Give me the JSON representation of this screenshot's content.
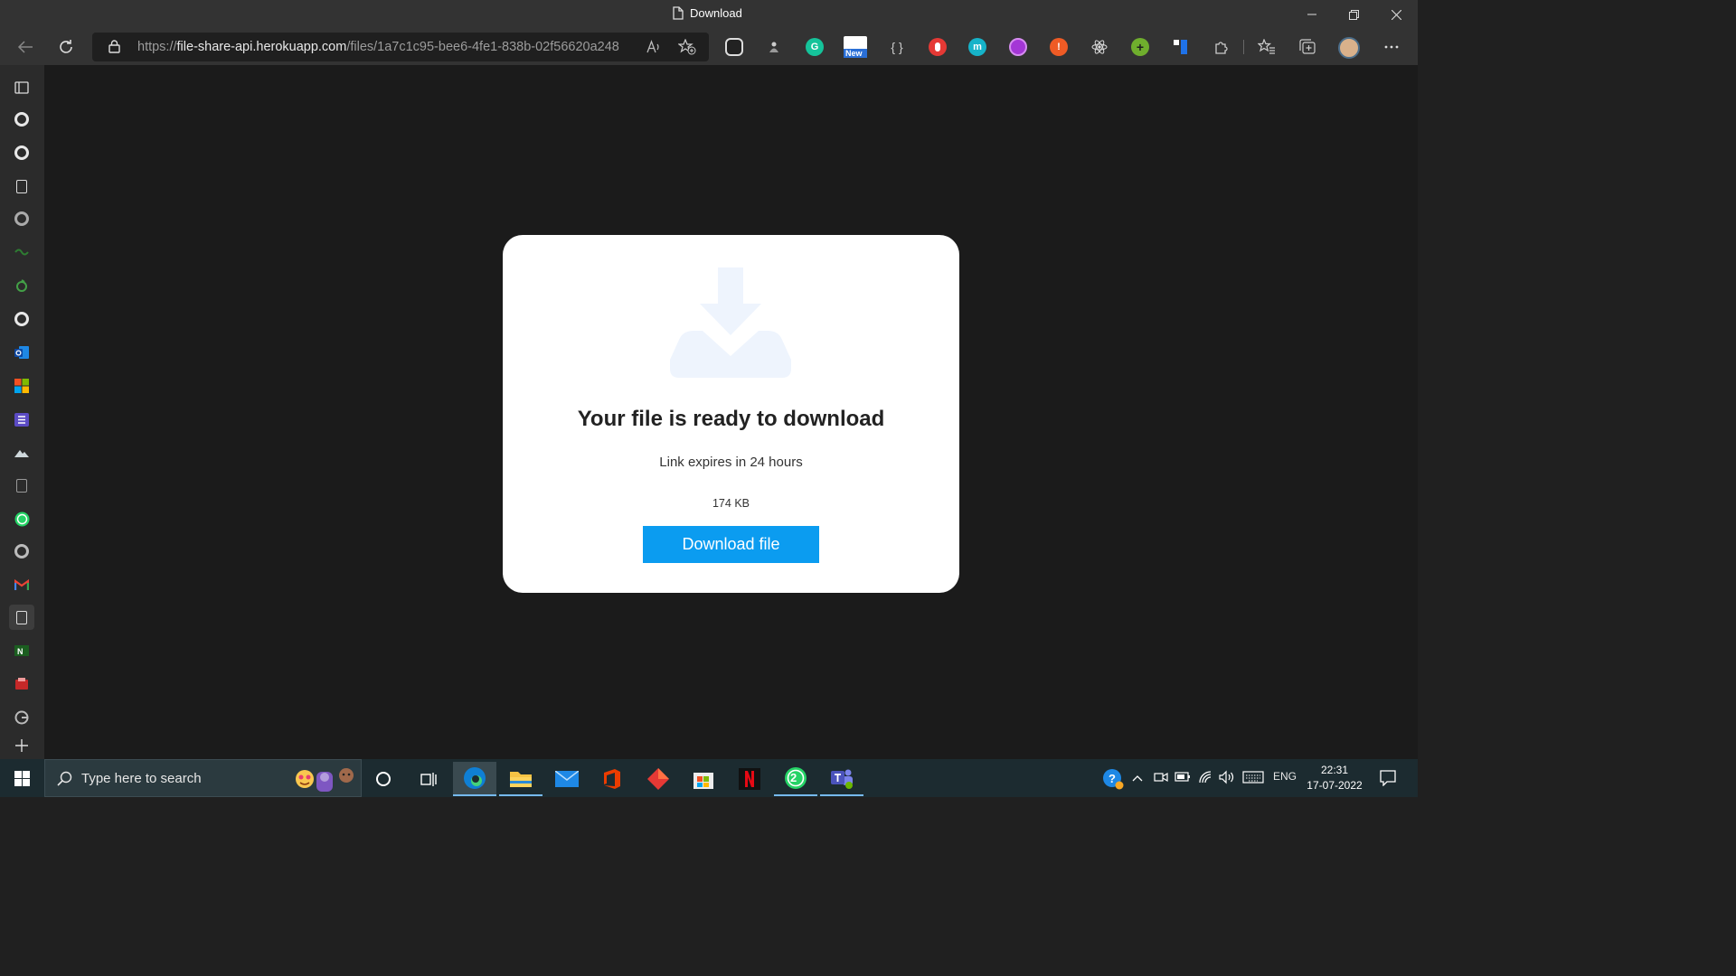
{
  "window": {
    "tab_title": "Download",
    "controls": [
      "minimize",
      "restore",
      "close"
    ]
  },
  "toolbar": {
    "url_scheme": "https://",
    "url_host": "file-share-api.herokuapp.com",
    "url_path": "/files/1a7c1c95-bee6-4fe1-838b-02f56620a248",
    "new_badge": "New",
    "extensions": [
      {
        "name": "screen-capture-icon",
        "color": "#d8d8d8"
      },
      {
        "name": "anchor-extension-icon",
        "color": "#bcbcbc"
      },
      {
        "name": "grammarly-icon",
        "color": "#15c39a",
        "label": "G"
      },
      {
        "name": "new-extension-icon",
        "color": "#2a6fd6"
      },
      {
        "name": "json-formatter-icon",
        "color": "#cccccc"
      },
      {
        "name": "hand-extension-icon",
        "color": "#e53935"
      },
      {
        "name": "m-extension-icon",
        "color": "#16b3c9",
        "label": "m"
      },
      {
        "name": "purple-extension-icon",
        "color": "#a436d6"
      },
      {
        "name": "alert-extension-icon",
        "color": "#ef5b25",
        "label": "!"
      },
      {
        "name": "react-devtools-icon",
        "color": "#d6d6d6"
      },
      {
        "name": "plus-extension-icon",
        "color": "#6fae2d",
        "label": "+"
      },
      {
        "name": "trello-icon",
        "color": "#1f72e8"
      }
    ]
  },
  "sidebar": {
    "items": [
      {
        "name": "sidebar-tab-actions-icon",
        "kind": "doc"
      },
      {
        "name": "sidebar-github-icon-1",
        "kind": "gh"
      },
      {
        "name": "sidebar-github-icon-2",
        "kind": "gh"
      },
      {
        "name": "sidebar-document-icon-1",
        "kind": "doc"
      },
      {
        "name": "sidebar-github-icon-3",
        "kind": "gh-dim"
      },
      {
        "name": "sidebar-green-icon-1",
        "kind": "green"
      },
      {
        "name": "sidebar-green-icon-2",
        "kind": "green"
      },
      {
        "name": "sidebar-github-icon-4",
        "kind": "gh"
      },
      {
        "name": "sidebar-outlook-icon",
        "kind": "outlook"
      },
      {
        "name": "sidebar-microsoft-icon",
        "kind": "ms"
      },
      {
        "name": "sidebar-forms-icon",
        "kind": "forms"
      },
      {
        "name": "sidebar-landscape-icon",
        "kind": "landscape"
      },
      {
        "name": "sidebar-document-icon-2",
        "kind": "doc-dim"
      },
      {
        "name": "sidebar-whatsapp-icon",
        "kind": "whatsapp"
      },
      {
        "name": "sidebar-github-icon-5",
        "kind": "gh"
      },
      {
        "name": "sidebar-gmail-icon",
        "kind": "gmail"
      },
      {
        "name": "sidebar-document-icon-3",
        "kind": "doc-active"
      },
      {
        "name": "sidebar-n-icon",
        "kind": "n"
      },
      {
        "name": "sidebar-pdf-icon",
        "kind": "pdf"
      },
      {
        "name": "sidebar-google-icon",
        "kind": "google"
      },
      {
        "name": "sidebar-add-icon",
        "kind": "plus"
      }
    ]
  },
  "card": {
    "title": "Your file is ready to download",
    "subtitle": "Link expires in 24 hours",
    "size": "174 KB",
    "button_label": "Download file",
    "accent": "#0b9cf0",
    "icon_color": "#eef4fd"
  },
  "taskbar": {
    "search_placeholder": "Type here to search",
    "apps": [
      "cortana",
      "task-view",
      "edge",
      "file-explorer",
      "mail",
      "office",
      "app-red",
      "store",
      "netflix",
      "whatsapp",
      "teams"
    ],
    "whatsapp_badge": "2",
    "language": "ENG",
    "time": "22:31",
    "date": "17-07-2022"
  },
  "colors": {
    "titlebar": "#333333",
    "content_bg": "#1b1b1b",
    "taskbar": "#1c2b30"
  }
}
